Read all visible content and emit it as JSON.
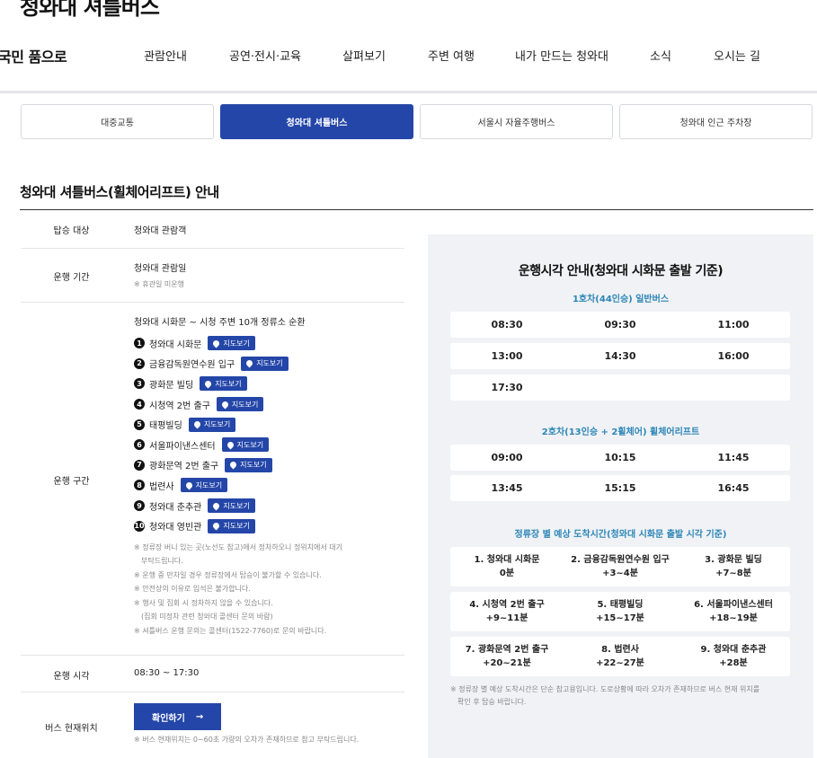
{
  "header": {
    "site_title": "청와대 셔틀버스",
    "slogan": "국민 품으로",
    "nav": [
      "관람안내",
      "공연·전시·교육",
      "살펴보기",
      "주변 여행",
      "내가 만드는 청와대",
      "소식",
      "오시는 길"
    ]
  },
  "tabs": [
    "대중교통",
    "청와대 셔틀버스",
    "서울시 자율주행버스",
    "청와대 인근 주차장"
  ],
  "active_tab": 1,
  "page_heading": "청와대 셔틀버스(휠체어리프트) 안내",
  "info": {
    "target_label": "탑승 대상",
    "target_value": "청와대 관람객",
    "period_label": "운행 기간",
    "period_value": "청와대 관람일",
    "period_note": "※ 휴관일 미운행",
    "route_label": "운행 구간",
    "route_intro": "청와대 시화문 ~ 시청 주변 10개 정류소 순환",
    "map_button": "지도보기",
    "stops": [
      "청와대 시화문",
      "금융감독원연수원 입구",
      "광화문 빌딩",
      "시청역 2번 출구",
      "태평빌딩",
      "서울파이낸스센터",
      "광화문역 2번 출구",
      "법련사",
      "청와대 춘추관",
      "청와대 영빈관"
    ],
    "route_notes": [
      "※ 정류장 버니 있는 곳(노선도 참고)에서 정차하오니 정위치에서 대기",
      "부탁드립니다.",
      "※ 운행 중 만차일 경우 정류장에서 탑승이 불가할 수 있습니다.",
      "※ 안전상의 이유로 입석은 불가합니다.",
      "※ 행사 및 집회 시 정차하지 않을 수 있습니다.",
      "(집회 미정차 관련 청와대 콜센터 문의 바람)",
      "※ 셔틀버스 운행 문의는 콜센터(1522-7760)로 문의 바랍니다."
    ],
    "time_label": "운행 시각",
    "time_value": "08:30 ~ 17:30",
    "location_label": "버스 현재위치",
    "confirm_button": "확인하기",
    "arrow": "→",
    "location_note": "※ 버스 현재위치는 0~60초 가량의 오차가 존재하므로 참고 부탁드립니다."
  },
  "schedule": {
    "title": "운행시각 안내(청와대 시화문 출발 기준)",
    "bus1_title": "1호차(44인승) 일반버스",
    "bus1_times": [
      [
        "08:30",
        "09:30",
        "11:00"
      ],
      [
        "13:00",
        "14:30",
        "16:00"
      ],
      [
        "17:30"
      ]
    ],
    "bus2_title": "2호차(13인승 + 2휠체어) 휠체어리프트",
    "bus2_times": [
      [
        "09:00",
        "10:15",
        "11:45"
      ],
      [
        "13:45",
        "15:15",
        "16:45"
      ]
    ],
    "eta_title": "정류장 별 예상 도착시간(청와대 시화문 출발 시각 기준)",
    "eta": [
      [
        {
          "stop": "1. 청와대 시화문",
          "time": "0분"
        },
        {
          "stop": "2. 금융감독원연수원 입구",
          "time": "+3~4분"
        },
        {
          "stop": "3. 광화문 빌딩",
          "time": "+7~8분"
        }
      ],
      [
        {
          "stop": "4. 시청역 2번 출구",
          "time": "+9~11분"
        },
        {
          "stop": "5. 태평빌딩",
          "time": "+15~17분"
        },
        {
          "stop": "6. 서울파이낸스센터",
          "time": "+18~19분"
        }
      ],
      [
        {
          "stop": "7. 광화문역 2번 출구",
          "time": "+20~21분"
        },
        {
          "stop": "8. 법련사",
          "time": "+22~27분"
        },
        {
          "stop": "9. 청와대 춘추관",
          "time": "+28분"
        }
      ]
    ],
    "note_line1": "※ 정류장 별 예상 도착시간은 단순 참고용입니다. 도로상황에 따라 오차가 존재하므로 버스 현재 위치를",
    "note_line2": "확인 후 탑승 바랍니다."
  },
  "colors": {
    "accent": "#2446a8",
    "subtitle": "#2d86b7",
    "panel_bg": "#f0f2f5"
  }
}
